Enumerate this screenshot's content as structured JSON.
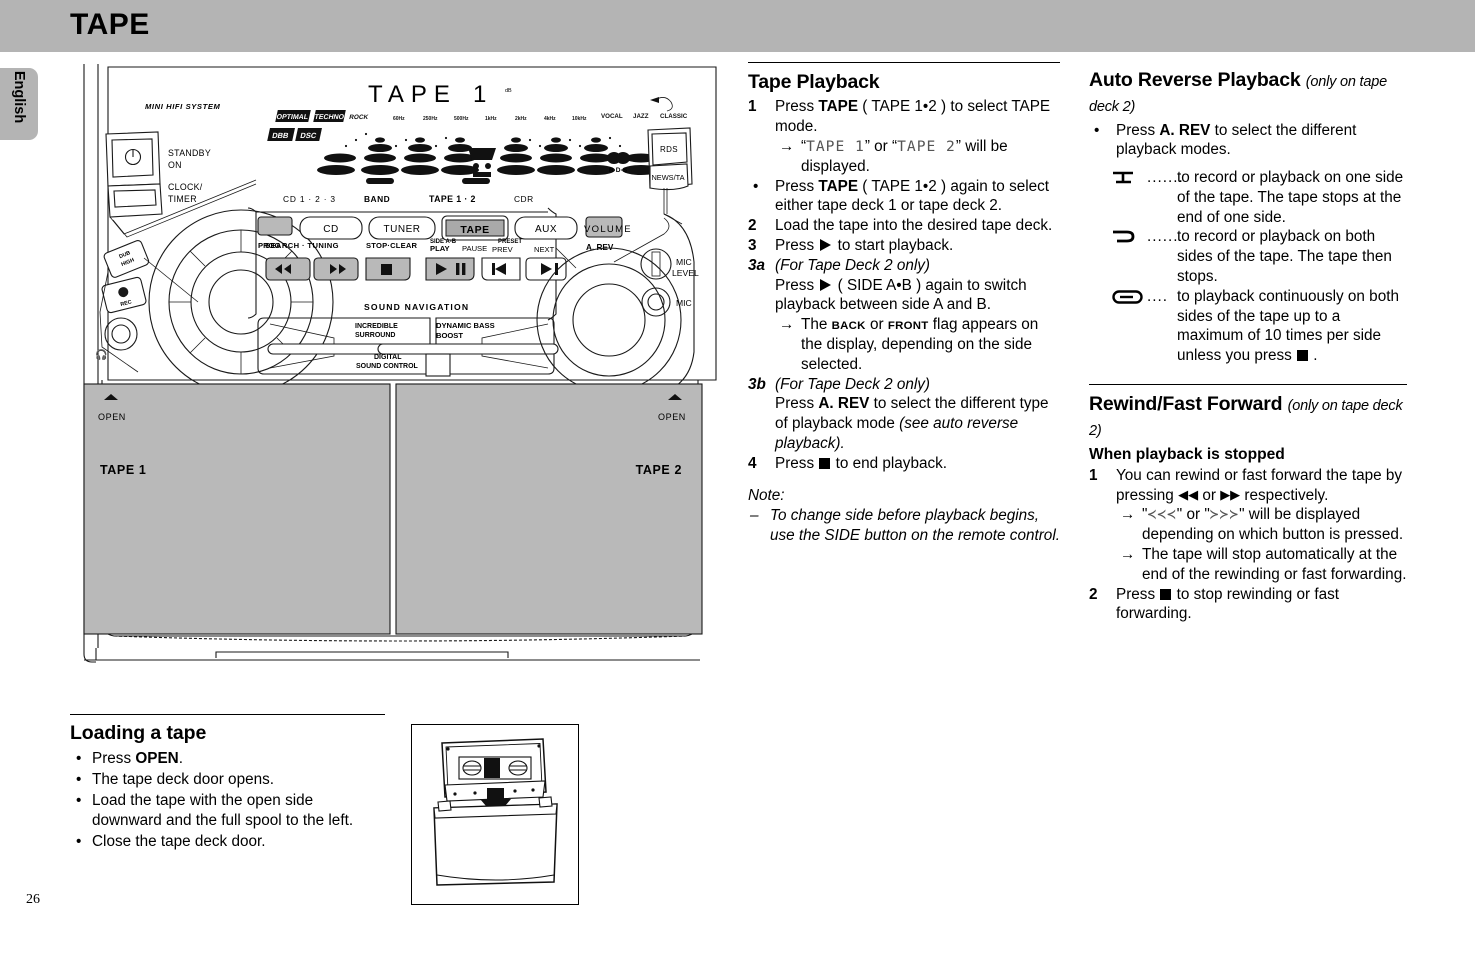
{
  "header": {
    "title": "TAPE"
  },
  "sidebar": {
    "language_tab": "English",
    "page_number": "26"
  },
  "figure_hifi": {
    "brand_line": "MINI HIFI SYSTEM",
    "labels": {
      "standby": "STANDBY",
      "on": "ON",
      "clock": "CLOCK/",
      "timer": "TIMER",
      "dub_high": "DUB HIGH",
      "rec": "REC",
      "prog": "PROG",
      "cd_123": "CD 1 · 2 · 3",
      "band": "BAND",
      "tape_12": "TAPE 1 · 2",
      "cdr": "CDR",
      "cd": "CD",
      "tuner": "TUNER",
      "tape": "TAPE",
      "aux": "AUX",
      "a_rev": "A. REV",
      "search_tuning": "SEARCH · TUNING",
      "stop_clear": "STOP·CLEAR",
      "side_ab": "SIDE A-B",
      "play": "PLAY",
      "pause": "PAUSE",
      "preset": "PRESET",
      "prev": "PREV",
      "next": "NEXT",
      "sound_navigation": "SOUND NAVIGATION",
      "incredible_surround": "INCREDIBLE SURROUND",
      "dynamic_bass_boost": "DYNAMIC BASS BOOST",
      "digital_sound_control": "DIGITAL SOUND CONTROL",
      "volume": "VOLUME",
      "rds": "RDS",
      "news_ta": "NEWS/TA",
      "rds_logo": "R·D·S",
      "mic_level": "MIC LEVEL",
      "mic": "MIC",
      "open_left": "OPEN",
      "open_right": "OPEN",
      "tape_1": "TAPE 1",
      "tape_2": "TAPE 2"
    },
    "display": {
      "main_text": "TAPE  1",
      "indicators": [
        "OPTIMAL",
        "TECHNO",
        "ROCK",
        "VOCAL",
        "JAZZ",
        "CLASSIC",
        "DBB",
        "DSC"
      ],
      "band_labels": [
        "60Hz",
        "250Hz",
        "500Hz",
        "1kHz",
        "2kHz",
        "4kHz",
        "10kHz"
      ]
    }
  },
  "loading_a_tape": {
    "title": "Loading a tape",
    "items": [
      {
        "pre": "Press ",
        "bold": "OPEN",
        "post": "."
      },
      {
        "pre": "The tape deck door opens.",
        "bold": "",
        "post": ""
      },
      {
        "pre": "Load the tape with the open side downward and the full spool to the left.",
        "bold": "",
        "post": ""
      },
      {
        "pre": "Close the tape deck door.",
        "bold": "",
        "post": ""
      }
    ]
  },
  "tape_playback": {
    "title": "Tape Playback",
    "step1": {
      "marker": "1",
      "pre": "Press ",
      "bold": "TAPE",
      "post": " ( TAPE 1•2 ) to select TAPE mode."
    },
    "step1_arrow": {
      "quote_open": "“",
      "lcd1": "TAPE  1",
      "mid": "” or “",
      "lcd2": "TAPE  2",
      "tail": "” will be displayed."
    },
    "step1_bullet": {
      "marker": "•",
      "pre": "Press ",
      "bold": "TAPE",
      "post": " ( TAPE 1•2 ) again to select either tape deck 1 or tape deck 2."
    },
    "step2": {
      "marker": "2",
      "text": "Load the tape into the desired tape deck."
    },
    "step3": {
      "marker": "3",
      "pre": "Press ",
      "post": " to start playback."
    },
    "step3a": {
      "marker": "3a",
      "italic_head": "(For Tape Deck 2 only)",
      "pre": "Press ",
      "post": " ( SIDE A•B ) again to switch playback between side A and B."
    },
    "step3a_arrow": {
      "pre": "The ",
      "flag1": "BACK",
      "mid": " or ",
      "flag2": "FRONT",
      "post": " flag appears on the display, depending on the side selected."
    },
    "step3b": {
      "marker": "3b",
      "italic_head": "(For Tape Deck 2 only)",
      "pre": "Press ",
      "bold": "A. REV",
      "mid": " to select the different type of playback mode ",
      "italic_tail": "(see auto reverse playback)."
    },
    "step4": {
      "marker": "4",
      "pre": "Press ",
      "post": " to end playback."
    },
    "note": {
      "label": "Note:",
      "dash": "–",
      "text": "To change side before playback begins, use the SIDE button on the remote control."
    }
  },
  "auto_reverse": {
    "title": "Auto Reverse Playback",
    "title_sub": "(only on tape deck 2)",
    "bullet": {
      "marker": "•",
      "pre": "Press ",
      "bold": "A. REV",
      "post": " to select the different playback modes."
    },
    "modes": [
      {
        "icon": "auto-reverse-one-side-icon",
        "dots": ".......",
        "text": "to record or playback on one side of the tape. The tape stops at the end of one side."
      },
      {
        "icon": "auto-reverse-both-sides-icon",
        "dots": "......",
        "text": "to record or playback on both sides of the tape. The tape then stops."
      },
      {
        "icon": "auto-reverse-continuous-icon",
        "dots": "....",
        "text_pre": "to playback continuously on both sides of the tape up to a maximum of 10 times per side unless you press ",
        "text_post": " ."
      }
    ]
  },
  "rewind_fast_forward": {
    "title": "Rewind/Fast Forward",
    "title_sub": "(only on tape deck 2)",
    "subhead": "When playback is stopped",
    "step1": {
      "marker": "1",
      "pre": "You can rewind or fast forward the tape by pressing ",
      "mid": " or ",
      "post": " respectively."
    },
    "step1_arrow1": {
      "q1": "\"",
      "lcd_rew": "≺≺≺",
      "q2": "\" or \"",
      "lcd_ff": "≻≻≻",
      "q3": "\" will be displayed depending on which button is pressed."
    },
    "step1_arrow2": {
      "text": "The tape will stop automatically at the end of the rewinding or fast forwarding."
    },
    "step2": {
      "marker": "2",
      "pre": "Press ",
      "post": " to stop rewinding or fast forwarding."
    }
  }
}
